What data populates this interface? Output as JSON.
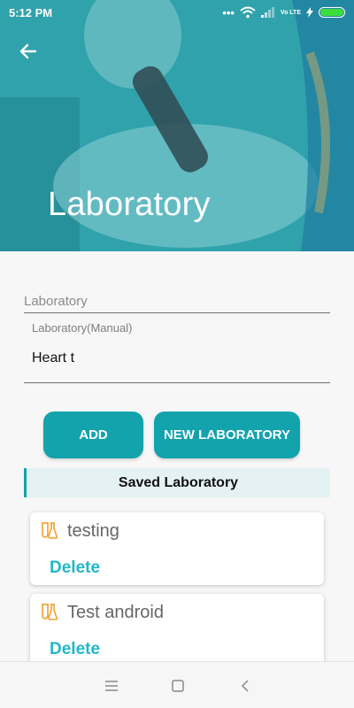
{
  "status_bar": {
    "time": "5:12 PM",
    "network_label": "Vo LTE",
    "icons": [
      "dots-icon",
      "wifi-icon",
      "signal-icon",
      "lte-icon",
      "charging-icon",
      "battery-icon"
    ]
  },
  "header": {
    "title": "Laboratory",
    "back_icon": "arrow-left-icon"
  },
  "form": {
    "laboratory_label": "Laboratory",
    "manual_label": "Laboratory(Manual)",
    "manual_value": "Heart t"
  },
  "buttons": {
    "add_label": "ADD",
    "new_label": "NEW LABORATORY"
  },
  "saved": {
    "title": "Saved Laboratory",
    "items": [
      {
        "name": "testing",
        "delete_label": "Delete",
        "icon": "flask-icon"
      },
      {
        "name": "Test android",
        "delete_label": "Delete",
        "icon": "flask-icon"
      }
    ]
  },
  "colors": {
    "accent": "#13a3ad",
    "delete": "#22b7c9",
    "flask": "#f0a030",
    "header_tint": "#2fa6b0"
  },
  "navbar": {
    "icons": [
      "menu-icon",
      "home-icon",
      "back-icon"
    ]
  }
}
